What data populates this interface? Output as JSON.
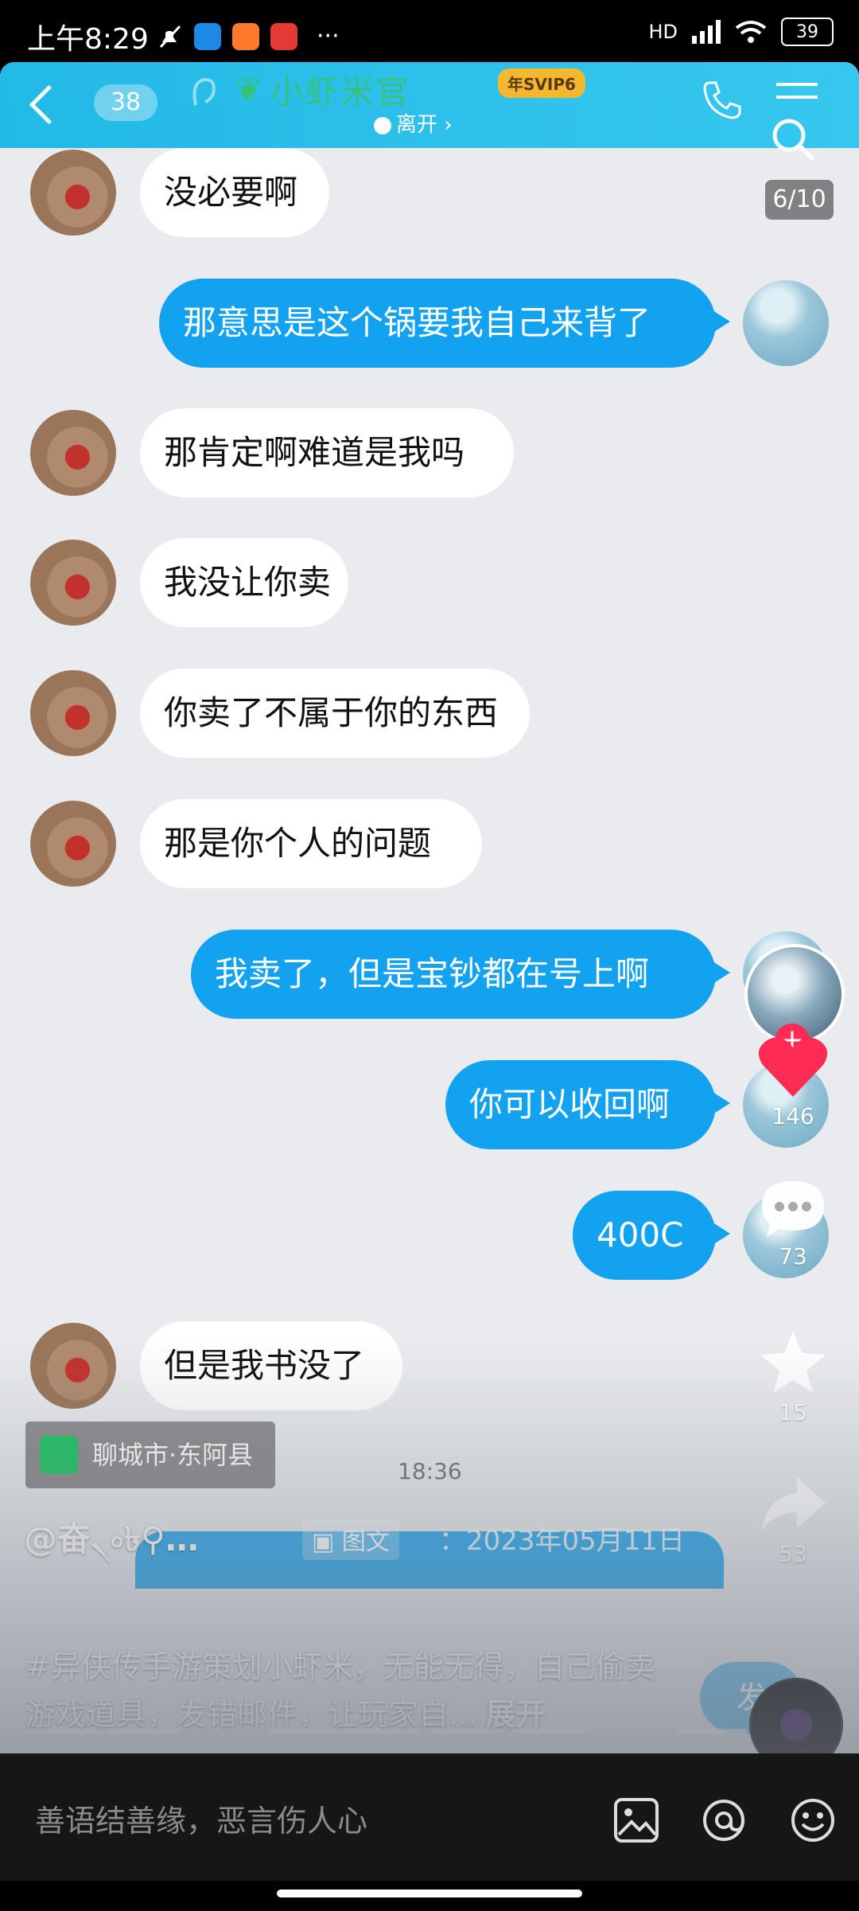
{
  "status_bar": {
    "time": "上午8:29",
    "battery": "39",
    "network": "HD",
    "dots": "···"
  },
  "chat": {
    "header": {
      "unread_count": "38",
      "contact_name": "小虾米官",
      "vip_badge": "年SVIP6",
      "presence": "离开",
      "presence_chevron": "›"
    },
    "page_counter": "6/10",
    "messages": [
      {
        "side": "left",
        "text": "没必要啊"
      },
      {
        "side": "right",
        "text": "那意思是这个锅要我自己来背了"
      },
      {
        "side": "left",
        "text": "那肯定啊难道是我吗"
      },
      {
        "side": "left",
        "text": "我没让你卖"
      },
      {
        "side": "left",
        "text": "你卖了不属于你的东西"
      },
      {
        "side": "left",
        "text": "那是你个人的问题"
      },
      {
        "side": "right",
        "text": "我卖了，但是宝钞都在号上啊"
      },
      {
        "side": "right",
        "text": "你可以收回啊"
      },
      {
        "side": "right",
        "text": "400C"
      },
      {
        "side": "left",
        "text": "但是我书没了"
      }
    ],
    "time_stamp": "18:36",
    "date_line": "：2023年05月11日"
  },
  "video": {
    "location": "聊城市·东阿县",
    "username": "@奋৲৹৳⚲…",
    "tag": "图文",
    "description": "#异侠传手游策划小虾米，无能无得，自己偷卖游戏道具，发错邮件，让玩家自...",
    "expand_label": "展开",
    "send_label": "发"
  },
  "rail": {
    "likes": "146",
    "comments": "73",
    "favorites": "15",
    "shares": "53"
  },
  "comment_bar": {
    "placeholder": "善语结善缘，恶言伤人心"
  },
  "colors": {
    "chat_blue": "#13a2ef",
    "header_teal": "#12b5e6",
    "like_red": "#fe2c55",
    "location_green": "#20c565"
  }
}
